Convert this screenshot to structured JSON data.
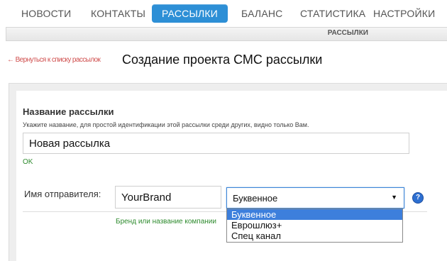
{
  "nav": {
    "items": [
      {
        "label": "НОВОСТИ"
      },
      {
        "label": "КОНТАКТЫ"
      },
      {
        "label": "РАССЫЛКИ"
      },
      {
        "label": "БАЛАНС"
      },
      {
        "label": "СТАТИСТИКА"
      },
      {
        "label": "НАСТРОЙКИ"
      }
    ],
    "active_index": 2,
    "accent_color": "#2d8fd6"
  },
  "subbar": {
    "label": "РАССЫЛКИ"
  },
  "header": {
    "back_link": "← Вернуться к списку рассылок",
    "title": "Создание проекта СМС рассылки"
  },
  "form": {
    "name_section": {
      "title": "Название рассылки",
      "hint": "Укажите название, для простой идентификации этой рассылки среди других, видно только Вам.",
      "value": "Новая рассылка",
      "status": "OK"
    },
    "sender": {
      "label": "Имя отправителя:",
      "value": "YourBrand",
      "hint": "Бренд или название компании",
      "select_value": "Буквенное",
      "select_arrow": "▼",
      "options": [
        "Буквенное",
        "Еврошлюз+",
        "Спец канал"
      ],
      "selected_option_index": 0,
      "help_icon": "?"
    }
  },
  "colors": {
    "back_link": "#d0504f",
    "ok": "#2e8b2e",
    "dropdown_selected": "#3d7fdc",
    "help_icon": "#2d6fd1"
  }
}
